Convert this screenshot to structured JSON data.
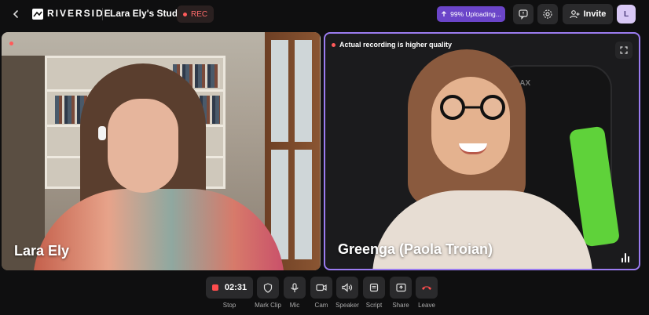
{
  "header": {
    "brand": "RIVERSIDE",
    "studio_name": "Lara Ely's Studio",
    "rec_label": "REC",
    "upload_status": "99% Uploading...",
    "invite_label": "Invite",
    "avatar_initial": "L"
  },
  "tiles": {
    "left": {
      "name": "Lara Ely"
    },
    "right": {
      "name": "Greenga (Paola Troian)",
      "quality_note": "Actual recording is higher quality",
      "chair_brand": "RAX"
    }
  },
  "controls": {
    "timer": "02:31",
    "stop_label": "Stop",
    "mark_clip_label": "Mark Clip",
    "mic_label": "Mic",
    "cam_label": "Cam",
    "speaker_label": "Speaker",
    "script_label": "Script",
    "share_label": "Share",
    "leave_label": "Leave"
  },
  "colors": {
    "accent": "#9b7cf0",
    "upload": "#6b45c9",
    "rec": "#ff5a5a",
    "leave": "#ff4d4d"
  },
  "icons": [
    "back-arrow-icon",
    "riverside-logo-icon",
    "upload-arrow-icon",
    "feedback-icon",
    "gear-icon",
    "invite-user-icon",
    "fullscreen-icon",
    "audio-level-icon",
    "shield-icon",
    "mic-icon",
    "cam-icon",
    "speaker-icon",
    "script-icon",
    "share-icon",
    "phone-hangup-icon"
  ]
}
